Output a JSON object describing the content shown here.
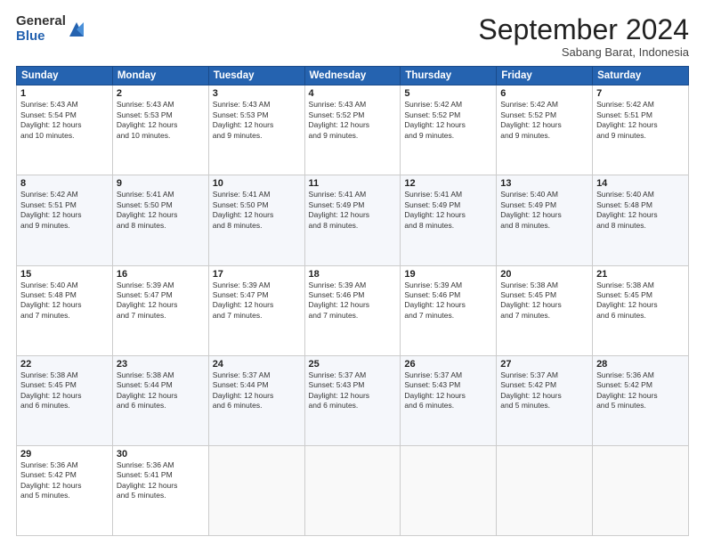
{
  "logo": {
    "general": "General",
    "blue": "Blue"
  },
  "title": "September 2024",
  "subtitle": "Sabang Barat, Indonesia",
  "days_header": [
    "Sunday",
    "Monday",
    "Tuesday",
    "Wednesday",
    "Thursday",
    "Friday",
    "Saturday"
  ],
  "weeks": [
    [
      {
        "day": "1",
        "info": "Sunrise: 5:43 AM\nSunset: 5:54 PM\nDaylight: 12 hours\nand 10 minutes."
      },
      {
        "day": "2",
        "info": "Sunrise: 5:43 AM\nSunset: 5:53 PM\nDaylight: 12 hours\nand 10 minutes."
      },
      {
        "day": "3",
        "info": "Sunrise: 5:43 AM\nSunset: 5:53 PM\nDaylight: 12 hours\nand 9 minutes."
      },
      {
        "day": "4",
        "info": "Sunrise: 5:43 AM\nSunset: 5:52 PM\nDaylight: 12 hours\nand 9 minutes."
      },
      {
        "day": "5",
        "info": "Sunrise: 5:42 AM\nSunset: 5:52 PM\nDaylight: 12 hours\nand 9 minutes."
      },
      {
        "day": "6",
        "info": "Sunrise: 5:42 AM\nSunset: 5:52 PM\nDaylight: 12 hours\nand 9 minutes."
      },
      {
        "day": "7",
        "info": "Sunrise: 5:42 AM\nSunset: 5:51 PM\nDaylight: 12 hours\nand 9 minutes."
      }
    ],
    [
      {
        "day": "8",
        "info": "Sunrise: 5:42 AM\nSunset: 5:51 PM\nDaylight: 12 hours\nand 9 minutes."
      },
      {
        "day": "9",
        "info": "Sunrise: 5:41 AM\nSunset: 5:50 PM\nDaylight: 12 hours\nand 8 minutes."
      },
      {
        "day": "10",
        "info": "Sunrise: 5:41 AM\nSunset: 5:50 PM\nDaylight: 12 hours\nand 8 minutes."
      },
      {
        "day": "11",
        "info": "Sunrise: 5:41 AM\nSunset: 5:49 PM\nDaylight: 12 hours\nand 8 minutes."
      },
      {
        "day": "12",
        "info": "Sunrise: 5:41 AM\nSunset: 5:49 PM\nDaylight: 12 hours\nand 8 minutes."
      },
      {
        "day": "13",
        "info": "Sunrise: 5:40 AM\nSunset: 5:49 PM\nDaylight: 12 hours\nand 8 minutes."
      },
      {
        "day": "14",
        "info": "Sunrise: 5:40 AM\nSunset: 5:48 PM\nDaylight: 12 hours\nand 8 minutes."
      }
    ],
    [
      {
        "day": "15",
        "info": "Sunrise: 5:40 AM\nSunset: 5:48 PM\nDaylight: 12 hours\nand 7 minutes."
      },
      {
        "day": "16",
        "info": "Sunrise: 5:39 AM\nSunset: 5:47 PM\nDaylight: 12 hours\nand 7 minutes."
      },
      {
        "day": "17",
        "info": "Sunrise: 5:39 AM\nSunset: 5:47 PM\nDaylight: 12 hours\nand 7 minutes."
      },
      {
        "day": "18",
        "info": "Sunrise: 5:39 AM\nSunset: 5:46 PM\nDaylight: 12 hours\nand 7 minutes."
      },
      {
        "day": "19",
        "info": "Sunrise: 5:39 AM\nSunset: 5:46 PM\nDaylight: 12 hours\nand 7 minutes."
      },
      {
        "day": "20",
        "info": "Sunrise: 5:38 AM\nSunset: 5:45 PM\nDaylight: 12 hours\nand 7 minutes."
      },
      {
        "day": "21",
        "info": "Sunrise: 5:38 AM\nSunset: 5:45 PM\nDaylight: 12 hours\nand 6 minutes."
      }
    ],
    [
      {
        "day": "22",
        "info": "Sunrise: 5:38 AM\nSunset: 5:45 PM\nDaylight: 12 hours\nand 6 minutes."
      },
      {
        "day": "23",
        "info": "Sunrise: 5:38 AM\nSunset: 5:44 PM\nDaylight: 12 hours\nand 6 minutes."
      },
      {
        "day": "24",
        "info": "Sunrise: 5:37 AM\nSunset: 5:44 PM\nDaylight: 12 hours\nand 6 minutes."
      },
      {
        "day": "25",
        "info": "Sunrise: 5:37 AM\nSunset: 5:43 PM\nDaylight: 12 hours\nand 6 minutes."
      },
      {
        "day": "26",
        "info": "Sunrise: 5:37 AM\nSunset: 5:43 PM\nDaylight: 12 hours\nand 6 minutes."
      },
      {
        "day": "27",
        "info": "Sunrise: 5:37 AM\nSunset: 5:42 PM\nDaylight: 12 hours\nand 5 minutes."
      },
      {
        "day": "28",
        "info": "Sunrise: 5:36 AM\nSunset: 5:42 PM\nDaylight: 12 hours\nand 5 minutes."
      }
    ],
    [
      {
        "day": "29",
        "info": "Sunrise: 5:36 AM\nSunset: 5:42 PM\nDaylight: 12 hours\nand 5 minutes."
      },
      {
        "day": "30",
        "info": "Sunrise: 5:36 AM\nSunset: 5:41 PM\nDaylight: 12 hours\nand 5 minutes."
      },
      {
        "day": "",
        "info": ""
      },
      {
        "day": "",
        "info": ""
      },
      {
        "day": "",
        "info": ""
      },
      {
        "day": "",
        "info": ""
      },
      {
        "day": "",
        "info": ""
      }
    ]
  ]
}
